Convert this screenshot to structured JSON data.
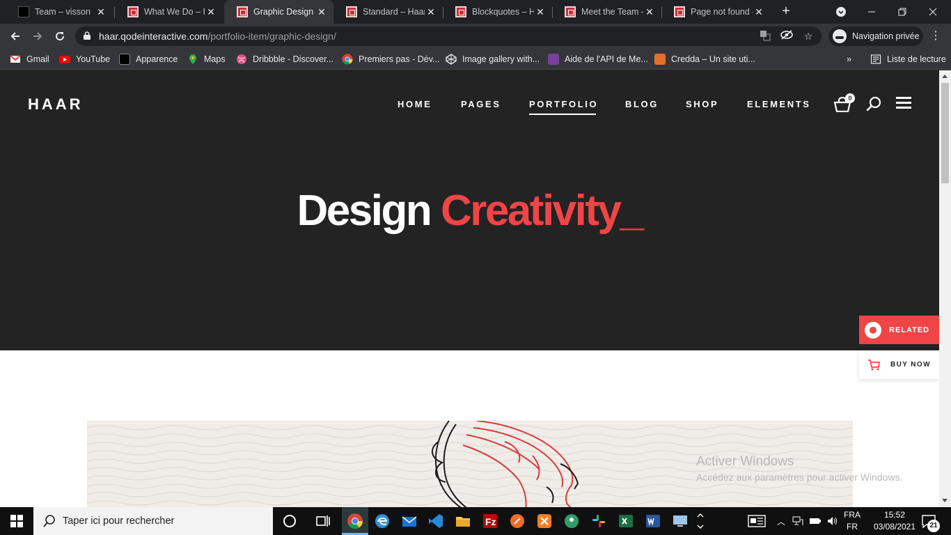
{
  "browser": {
    "tabs": [
      {
        "title": "Team – visson",
        "favicon": "visson-favicon",
        "active": false
      },
      {
        "title": "What We Do – Ha",
        "favicon": "haar-favicon",
        "active": false
      },
      {
        "title": "Graphic Design –",
        "favicon": "haar-favicon",
        "active": true
      },
      {
        "title": "Standard – Haar",
        "favicon": "haar-favicon",
        "active": false
      },
      {
        "title": "Blockquotes – Ha",
        "favicon": "haar-favicon",
        "active": false
      },
      {
        "title": "Meet the Team –",
        "favicon": "haar-favicon",
        "active": false
      },
      {
        "title": "Page not found –",
        "favicon": "haar-favicon",
        "active": false
      }
    ],
    "url_host": "haar.qodeinteractive.com",
    "url_path": "/portfolio-item/graphic-design/",
    "incognito_label": "Navigation privée",
    "bookmarks": [
      {
        "label": "Gmail",
        "icon": "gmail-icon"
      },
      {
        "label": "YouTube",
        "icon": "youtube-icon"
      },
      {
        "label": "Apparence",
        "icon": "visson-icon"
      },
      {
        "label": "Maps",
        "icon": "maps-icon"
      },
      {
        "label": "Dribbble - Discover...",
        "icon": "dribbble-icon"
      },
      {
        "label": "Premiers pas - Dév...",
        "icon": "chrome-icon"
      },
      {
        "label": "Image gallery with...",
        "icon": "codepen-icon"
      },
      {
        "label": "Aide de l'API de Me...",
        "icon": "mailchimp-icon"
      },
      {
        "label": "Credda – Un site uti...",
        "icon": "credda-icon"
      }
    ],
    "reading_list_label": "Liste de lecture"
  },
  "site": {
    "logo": "HAAR",
    "nav": [
      "HOME",
      "PAGES",
      "PORTFOLIO",
      "BLOG",
      "SHOP",
      "ELEMENTS"
    ],
    "active_nav": "PORTFOLIO",
    "cart_count": "0",
    "headline_white": "Design",
    "headline_red": "Creativity_",
    "related_label": "RELATED",
    "buy_now_label": "BUY NOW",
    "accent_color": "#ef4546"
  },
  "windows_watermark": {
    "title": "Activer Windows",
    "subtitle": "Accédez aux paramètres pour activer Windows."
  },
  "taskbar": {
    "search_placeholder": "Taper ici pour rechercher",
    "lang_top": "FRA",
    "lang_bottom": "FR",
    "time": "15:52",
    "date": "03/08/2021",
    "notification_count": "21"
  }
}
